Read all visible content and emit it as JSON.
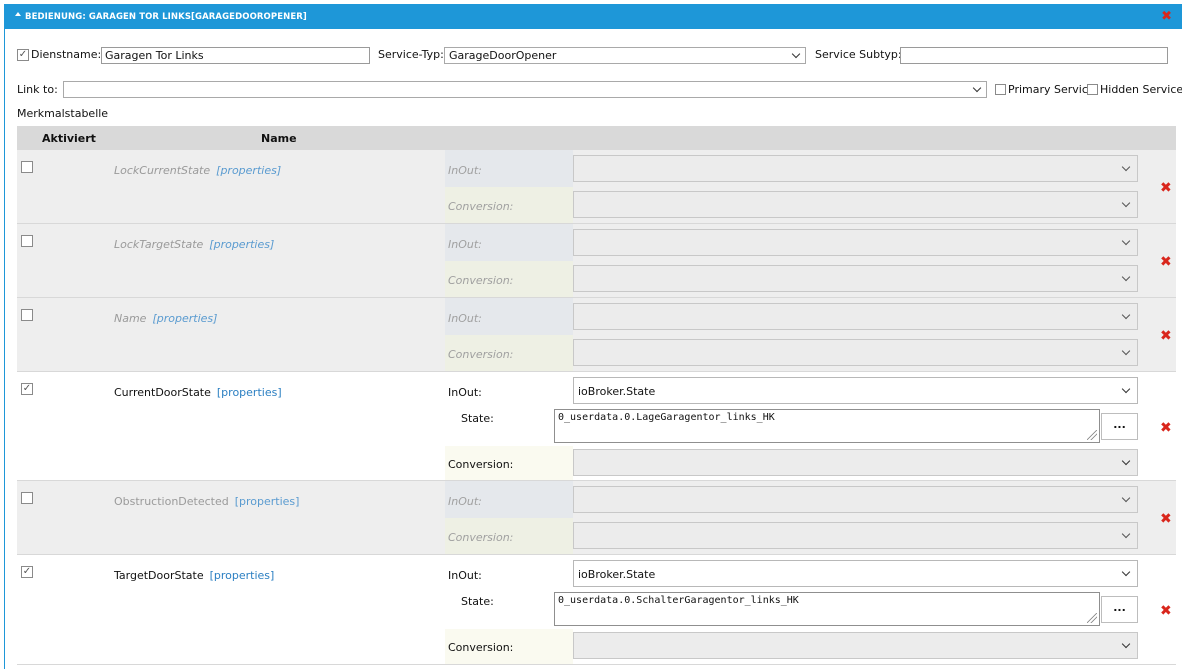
{
  "header": {
    "title": "BEDIENUNG: GARAGEN TOR LINKS[GARAGEDOOROPENER]"
  },
  "form": {
    "dienstname_label": "Dienstname:",
    "dienstname_value": "Garagen Tor Links",
    "dienstname_checked": true,
    "service_typ_label": "Service-Typ:",
    "service_typ_value": "GarageDoorOpener",
    "service_subtyp_label": "Service Subtyp:",
    "service_subtyp_value": "",
    "link_to_label": "Link to:",
    "link_to_value": "",
    "primary_service_label": "Primary Service",
    "hidden_service_label": "Hidden Service",
    "merkmalstabelle_label": "Merkmalstabelle"
  },
  "table": {
    "col_aktiviert": "Aktiviert",
    "col_name": "Name",
    "properties_link": "[properties]",
    "inout_label": "InOut:",
    "conversion_label": "Conversion:",
    "state_label": "State:",
    "dots_label": "...",
    "rows": [
      {
        "name": "LockCurrentState",
        "active": false
      },
      {
        "name": "LockTargetState",
        "active": false
      },
      {
        "name": "Name",
        "active": false
      },
      {
        "name": "CurrentDoorState",
        "active": true,
        "inout": "ioBroker.State",
        "state": "0_userdata.0.LageGaragentor_links_HK"
      },
      {
        "name": "ObstructionDetected",
        "active": false
      },
      {
        "name": "TargetDoorState",
        "active": true,
        "inout": "ioBroker.State",
        "state": "0_userdata.0.SchalterGaragentor_links_HK"
      }
    ]
  },
  "colors": {
    "header_bg": "#1e97d8",
    "delete_red": "#d9261c",
    "link_blue": "#2b7fc2"
  },
  "icons": {
    "close": "close-x-icon",
    "delete": "delete-x-icon",
    "dropdown": "chevron-down-icon",
    "check": "checkmark-icon"
  }
}
